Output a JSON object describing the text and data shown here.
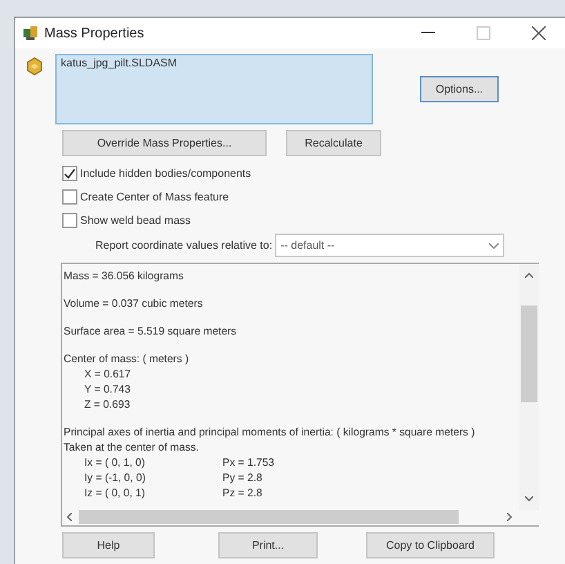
{
  "window": {
    "title": "Mass Properties"
  },
  "selection": {
    "items": [
      "katus_jpg_pilt.SLDASM"
    ]
  },
  "buttons": {
    "options": "Options...",
    "override": "Override Mass Properties...",
    "recalculate": "Recalculate"
  },
  "checkboxes": [
    {
      "label": "Include hidden bodies/components",
      "checked": true
    },
    {
      "label": "Create Center of Mass feature",
      "checked": false
    },
    {
      "label": "Show weld bead mass",
      "checked": false
    }
  ],
  "coordinates": {
    "label": "Report coordinate values relative to:",
    "value": "-- default --"
  },
  "results": [
    {
      "lines": [
        {
          "kind": "text",
          "text": "Mass = 36.056 kilograms"
        }
      ]
    },
    {
      "lines": [
        {
          "kind": "text",
          "text": "Volume = 0.037 cubic meters"
        }
      ]
    },
    {
      "lines": [
        {
          "kind": "text",
          "text": "Surface area = 5.519 square meters"
        }
      ]
    },
    {
      "lines": [
        {
          "kind": "text",
          "text": "Center of mass: ( meters )"
        },
        {
          "kind": "indented",
          "text": "X = 0.617"
        },
        {
          "kind": "indented",
          "text": "Y = 0.743"
        },
        {
          "kind": "indented",
          "text": "Z = 0.693"
        }
      ]
    },
    {
      "lines": [
        {
          "kind": "text",
          "text": "Principal axes of inertia and principal moments of inertia: ( kilograms * square meters )"
        },
        {
          "kind": "text",
          "text": "Taken at the center of mass."
        },
        {
          "kind": "pair",
          "axis": "Ix = ( 0,  1,  0)",
          "moment": "Px = 1.753"
        },
        {
          "kind": "pair",
          "axis": "Iy = (-1,  0,  0)",
          "moment": "Py = 2.8"
        },
        {
          "kind": "pair",
          "axis": "Iz = ( 0,  0,  1)",
          "moment": "Pz = 2.8"
        }
      ]
    }
  ],
  "footer_buttons": [
    "Help",
    "Print...",
    "Copy to Clipboard"
  ]
}
